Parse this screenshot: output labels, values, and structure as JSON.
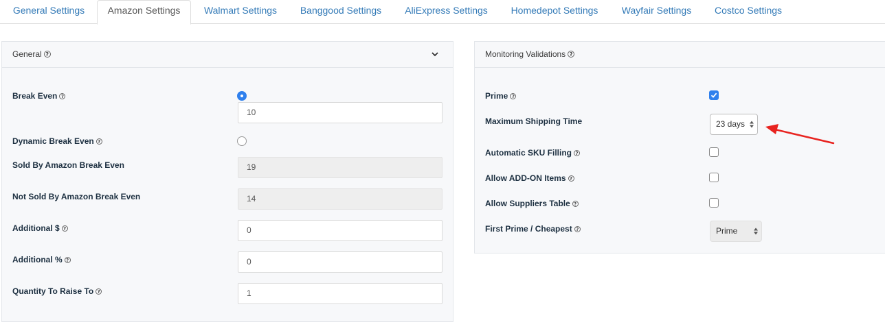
{
  "tabs": [
    {
      "label": "General Settings",
      "active": false
    },
    {
      "label": "Amazon Settings",
      "active": true
    },
    {
      "label": "Walmart Settings",
      "active": false
    },
    {
      "label": "Banggood Settings",
      "active": false
    },
    {
      "label": "AliExpress Settings",
      "active": false
    },
    {
      "label": "Homedepot Settings",
      "active": false
    },
    {
      "label": "Wayfair Settings",
      "active": false
    },
    {
      "label": "Costco Settings",
      "active": false
    }
  ],
  "help_glyph": "?",
  "general": {
    "title": "General",
    "break_even_label": "Break Even",
    "break_even_value": "10",
    "dynamic_break_even_label": "Dynamic Break Even",
    "sold_by_amazon_label": "Sold By Amazon Break Even",
    "sold_by_amazon_value": "19",
    "not_sold_by_amazon_label": "Not Sold By Amazon Break Even",
    "not_sold_by_amazon_value": "14",
    "additional_dollar_label": "Additional $",
    "additional_dollar_value": "0",
    "additional_percent_label": "Additional %",
    "additional_percent_value": "0",
    "quantity_raise_label": "Quantity To Raise To",
    "quantity_raise_value": "1",
    "break_even_selected": true,
    "dynamic_break_even_selected": false
  },
  "monitoring": {
    "title": "Monitoring Validations",
    "prime_label": "Prime",
    "prime_checked": true,
    "max_shipping_label": "Maximum Shipping Time",
    "max_shipping_value": "23 days",
    "auto_sku_label": "Automatic SKU Filling",
    "auto_sku_checked": false,
    "addon_label": "Allow ADD-ON Items",
    "addon_checked": false,
    "suppliers_table_label": "Allow Suppliers Table",
    "suppliers_table_checked": false,
    "first_prime_label": "First Prime / Cheapest",
    "first_prime_value": "Prime"
  },
  "colors": {
    "accent": "#2f80ed",
    "annotation_arrow": "#e8231f",
    "link": "#337ab7"
  }
}
